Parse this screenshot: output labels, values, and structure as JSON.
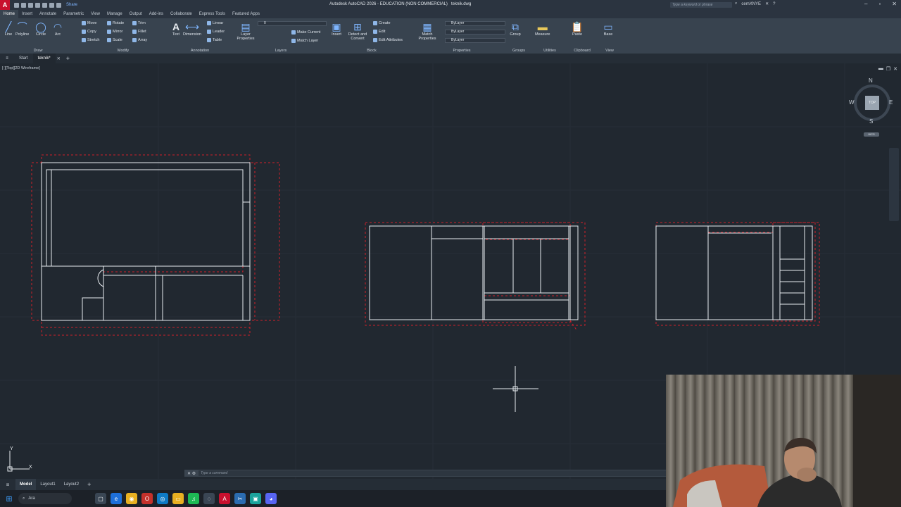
{
  "app": {
    "title": "Autodesk AutoCAD 2026 - EDUCATION (NON COMMERCIAL)",
    "filename": "teknik.dwg",
    "logo": "A",
    "share": "Share",
    "search_placeholder": "Type a keyword or phrase",
    "user": "cemXNYE"
  },
  "ribbon_tabs": [
    "Home",
    "Insert",
    "Annotate",
    "Parametric",
    "View",
    "Manage",
    "Output",
    "Add-ins",
    "Collaborate",
    "Express Tools",
    "Featured Apps"
  ],
  "ribbon": {
    "draw": {
      "title": "Draw",
      "line": "Line",
      "polyline": "Polyline",
      "circle": "Circle",
      "arc": "Arc"
    },
    "modify": {
      "title": "Modify",
      "move": "Move",
      "rotate": "Rotate",
      "trim": "Trim",
      "copy": "Copy",
      "mirror": "Mirror",
      "fillet": "Fillet",
      "stretch": "Stretch",
      "scale": "Scale",
      "array": "Array"
    },
    "annotation": {
      "title": "Annotation",
      "text": "Text",
      "dimension": "Dimension",
      "linear": "Linear",
      "leader": "Leader",
      "table": "Table"
    },
    "layers": {
      "title": "Layers",
      "layer_properties": "Layer Properties",
      "make_current": "Make Current",
      "match_layer": "Match Layer",
      "current_layer": "0"
    },
    "block": {
      "title": "Block",
      "insert": "Insert",
      "detect": "Detect and Convert",
      "create": "Create",
      "edit": "Edit",
      "edit_attributes": "Edit Attributes"
    },
    "properties": {
      "title": "Properties",
      "match": "Match Properties",
      "color": "ByLayer",
      "linetype": "ByLayer",
      "lineweight": "ByLayer"
    },
    "groups": {
      "title": "Groups",
      "group": "Group"
    },
    "utilities": {
      "title": "Utilities",
      "measure": "Measure"
    },
    "clipboard": {
      "title": "Clipboard",
      "paste": "Paste"
    },
    "view": {
      "title": "View",
      "base": "Base"
    }
  },
  "doc_tabs": [
    "Start",
    "teknik*"
  ],
  "viewport": {
    "label": "[-][Top][2D Wireframe]",
    "compass": {
      "n": "N",
      "s": "S",
      "e": "E",
      "w": "W",
      "top": "TOP",
      "wcs": "WCS"
    },
    "ucs": {
      "x": "X",
      "y": "Y"
    }
  },
  "command_placeholder": "Type a command",
  "layout_tabs": [
    "Model",
    "Layout1",
    "Layout2"
  ],
  "taskbar": {
    "search": "Ara"
  },
  "colors": {
    "accent": "#c8102e",
    "selection": "#d0202a",
    "linework": "#e8ecf0",
    "background": "#212830"
  }
}
